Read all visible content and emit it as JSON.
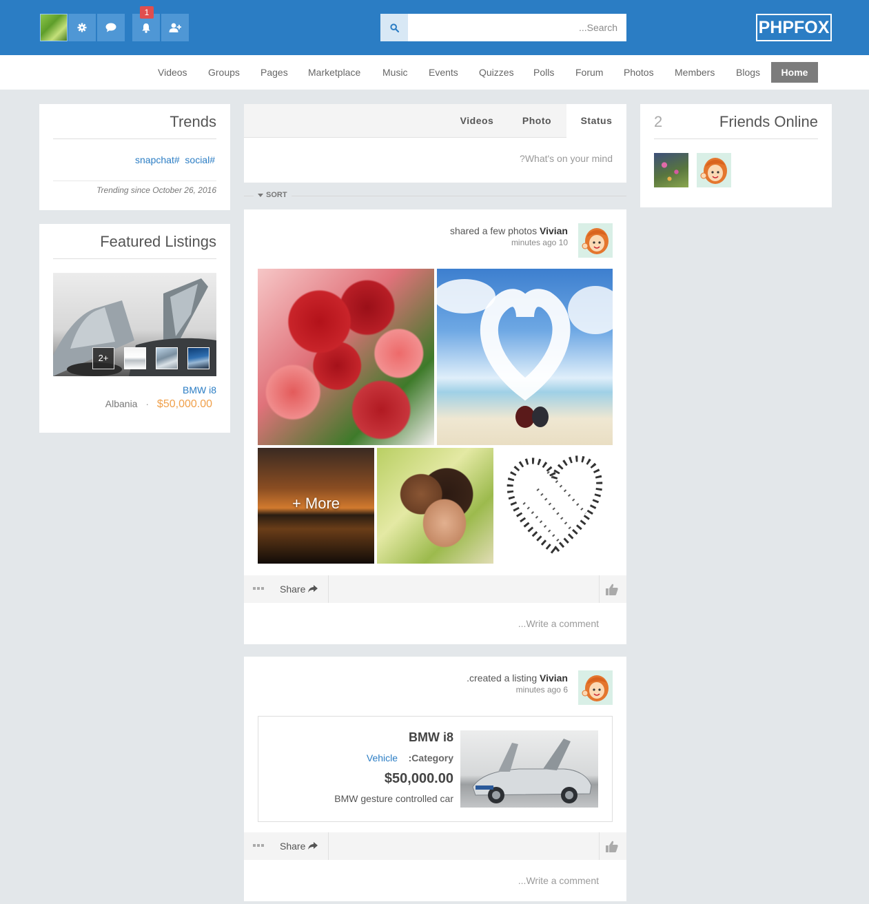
{
  "header": {
    "notification_count": "1",
    "search": {
      "placeholder": "...Search"
    },
    "logo": "PHPFOX"
  },
  "nav": {
    "items": [
      "Videos",
      "Groups",
      "Pages",
      "Marketplace",
      "Music",
      "Events",
      "Quizzes",
      "Polls",
      "Forum",
      "Photos",
      "Members",
      "Blogs"
    ],
    "active": "Home"
  },
  "trends": {
    "title": "Trends",
    "tags": [
      "snapchat#",
      "social#"
    ],
    "since": "Trending since October 26, 2016"
  },
  "featured": {
    "title": "Featured Listings",
    "more_count": "2+",
    "item_title": "BMW i8",
    "location": "Albania",
    "separator": "·",
    "price": "$50,000.00"
  },
  "composer": {
    "tabs": [
      "Videos",
      "Photo",
      "Status"
    ],
    "placeholder": "?What's on your mind"
  },
  "sort_label": "SORT",
  "posts": [
    {
      "action": "shared a few photos",
      "author": "Vivian",
      "time": "minutes ago 10",
      "more_label": "+ More",
      "share_label": "Share",
      "comment_placeholder": "...Write a comment"
    },
    {
      "action": ".created a listing",
      "author": "Vivian",
      "time": "minutes ago 6",
      "listing": {
        "title": "BMW i8",
        "category_value": "Vehicle",
        "category_label": ":Category",
        "price": "$50,000.00",
        "description": "BMW gesture controlled car"
      },
      "share_label": "Share",
      "comment_placeholder": "...Write a comment"
    }
  ],
  "friends_online": {
    "count": "2",
    "title": "Friends Online"
  },
  "colors": {
    "topbar": "#2b7dc4",
    "link": "#2b7dc4",
    "price": "#f0a04b",
    "badge": "#e04e4e"
  }
}
